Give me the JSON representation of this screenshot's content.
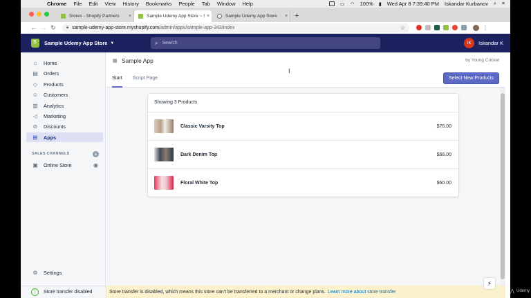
{
  "macos_menu": {
    "app": "Chrome",
    "items": [
      "File",
      "Edit",
      "View",
      "History",
      "Bookmarks",
      "People",
      "Tab",
      "Window",
      "Help"
    ],
    "battery": "100%",
    "datetime": "Wed Apr 8  7:39:40 PM",
    "user": "Iskandar Kurbanov"
  },
  "browser": {
    "tabs": [
      {
        "label": "Stores - Shopify Partners",
        "close": "×",
        "favicon_color": "#95bf47"
      },
      {
        "label": "Sample Udemy App Store ~ Sa",
        "close": "×",
        "favicon_color": "#95bf47"
      },
      {
        "label": "Sample Udemy App Store",
        "close": "×",
        "favicon_color": "#5f6368"
      }
    ],
    "new_tab": "+",
    "url_host": "sample-udemy-app-store.myshopify.com",
    "url_path": "/admin/apps/sample-app-343/index"
  },
  "topbar": {
    "store_name": "Sample Udemy App Store",
    "search_placeholder": "Search",
    "user_initials": "IK",
    "user_name": "Iskandar K"
  },
  "sidebar": {
    "items": [
      {
        "label": "Home",
        "icon": "home-icon"
      },
      {
        "label": "Orders",
        "icon": "orders-icon"
      },
      {
        "label": "Products",
        "icon": "tag-icon"
      },
      {
        "label": "Customers",
        "icon": "person-icon"
      },
      {
        "label": "Analytics",
        "icon": "bar-chart-icon"
      },
      {
        "label": "Marketing",
        "icon": "megaphone-icon"
      },
      {
        "label": "Discounts",
        "icon": "discount-icon"
      },
      {
        "label": "Apps",
        "icon": "apps-icon"
      }
    ],
    "active": "Apps",
    "channels_heading": "SALES CHANNELS",
    "online_store": "Online Store",
    "settings": "Settings",
    "store_transfer": "Store transfer disabled"
  },
  "app": {
    "title": "Sample App",
    "by": "by Young Cricket",
    "tabs": [
      "Start",
      "Script Page"
    ],
    "active_tab": "Start",
    "new_button": "Select New Products",
    "card_heading": "Showing 3 Products",
    "products": [
      {
        "name": "Classic Varsity Top",
        "price": "$76.00"
      },
      {
        "name": "Dark Denim Top",
        "price": "$66.00"
      },
      {
        "name": "Floral White Top",
        "price": "$60.00"
      }
    ]
  },
  "banner": {
    "text": "Store transfer is disabled, which means this store can't be transferred to a merchant or change plans.",
    "link": "Learn more about store transfer"
  },
  "watermark": "Udemy",
  "colors": {
    "shopify_nav": "#1c2260",
    "primary_button": "#5c6ac4",
    "active_nav_bg": "#dde0f5",
    "banner_bg": "#fcf1cd",
    "avatar_red": "#de3618"
  }
}
